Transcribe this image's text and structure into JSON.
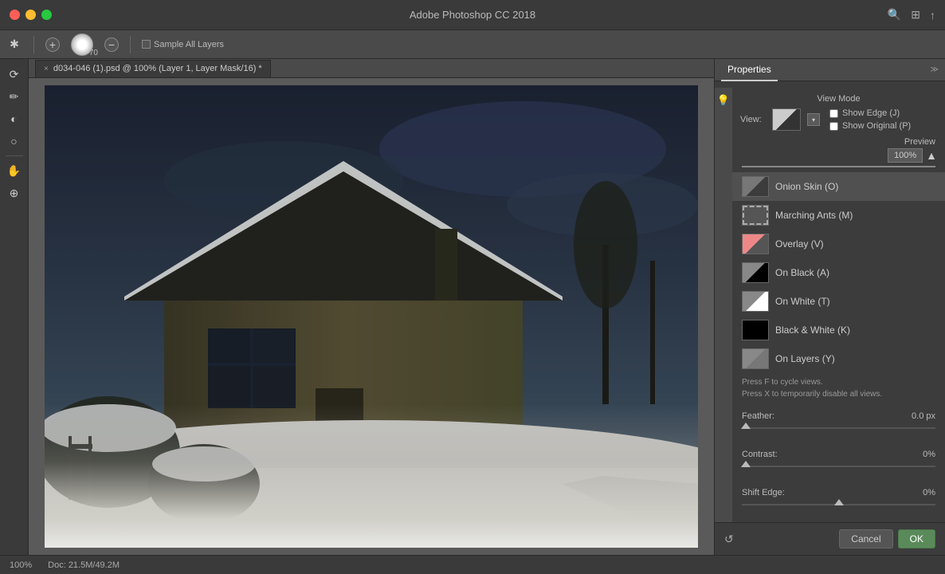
{
  "app": {
    "title": "Adobe Photoshop CC 2018",
    "brush_size": "70"
  },
  "titlebar": {
    "title": "Adobe Photoshop CC 2018",
    "search_icon": "🔍",
    "arrange_icon": "⊞",
    "share_icon": "↑"
  },
  "toolbar": {
    "sample_all_layers": "Sample All Layers",
    "add_icon": "+",
    "sub_icon": "−"
  },
  "tab": {
    "label": "d034-046 (1).psd @ 100% (Layer 1, Layer Mask/16) *"
  },
  "left_tools": [
    "✱",
    "✏",
    "◐",
    "○",
    "✋",
    "⊕"
  ],
  "properties_panel": {
    "tab_label": "Properties",
    "section_title": "View Mode",
    "view_label": "View:",
    "show_edge_label": "Show Edge (J)",
    "show_original_label": "Show Original (P)",
    "preview_label": "Preview",
    "preview_value": "100%",
    "view_modes": [
      {
        "id": "onion-skin",
        "label": "Onion Skin (O)",
        "selected": true
      },
      {
        "id": "marching-ants",
        "label": "Marching Ants (M)",
        "selected": false
      },
      {
        "id": "overlay",
        "label": "Overlay (V)",
        "selected": false
      },
      {
        "id": "on-black",
        "label": "On Black (A)",
        "selected": false
      },
      {
        "id": "on-white",
        "label": "On White (T)",
        "selected": false
      },
      {
        "id": "black-white",
        "label": "Black & White (K)",
        "selected": false
      },
      {
        "id": "on-layers",
        "label": "On Layers (Y)",
        "selected": false
      }
    ],
    "hint1": "Press F to cycle views.",
    "hint2": "Press X to temporarily disable all views.",
    "feather_label": "Feather:",
    "feather_value": "0.0 px",
    "contrast_label": "Contrast:",
    "contrast_value": "0%",
    "shift_edge_label": "Shift Edge:",
    "shift_edge_value": "0%"
  },
  "bottom_bar": {
    "zoom": "100%",
    "doc_info": "Doc: 21.5M/49.2M"
  },
  "buttons": {
    "cancel": "Cancel",
    "ok": "OK"
  }
}
